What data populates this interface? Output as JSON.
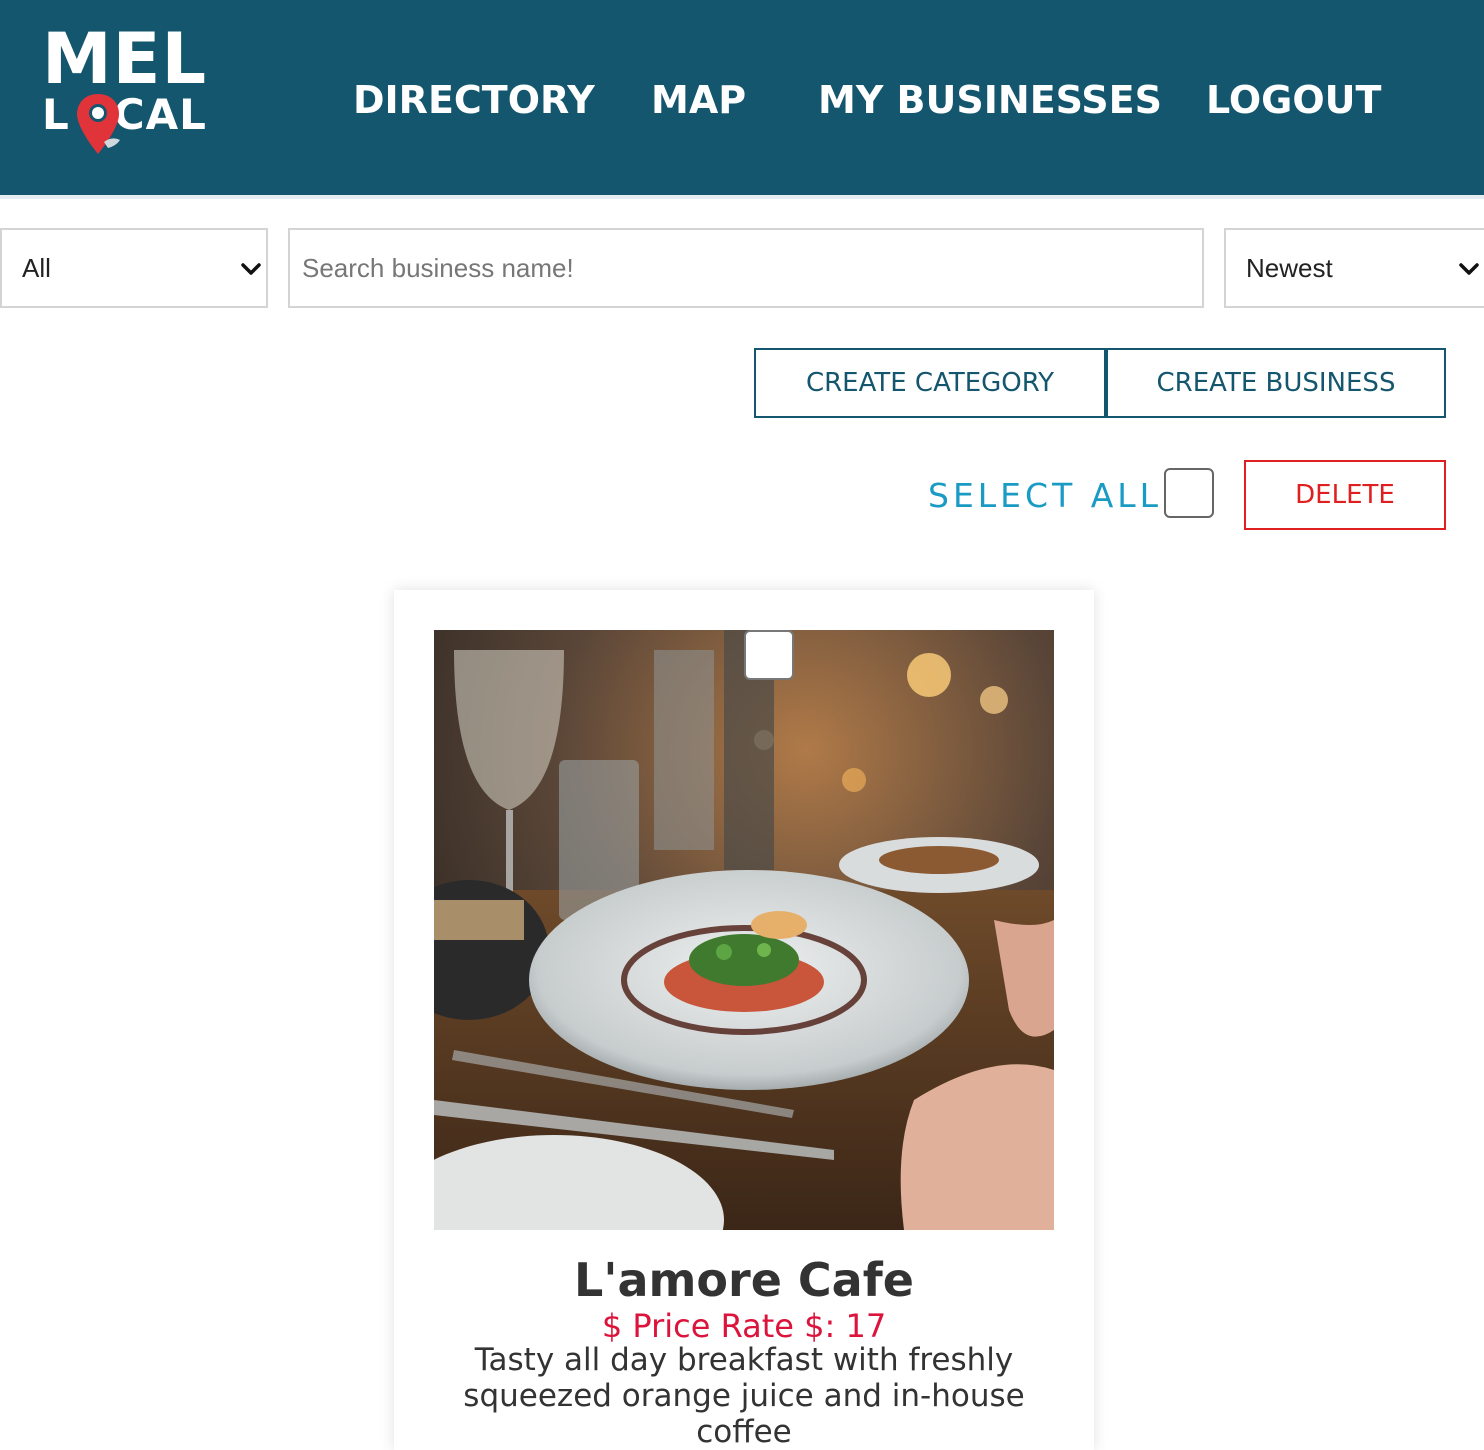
{
  "header": {
    "logo_top": "MEL",
    "logo_bottom_left": "L",
    "logo_bottom_right": "CAL",
    "nav": [
      "DIRECTORY",
      "MAP",
      "MY BUSINESSES",
      "LOGOUT"
    ],
    "background_color": "#14566e"
  },
  "filters": {
    "category_selected": "All",
    "search_placeholder": "Search business name!",
    "sort_selected": "Newest"
  },
  "actions": {
    "create_category": "CREATE CATEGORY",
    "create_business": "CREATE BUSINESS",
    "select_all": "SELECT ALL",
    "delete": "DELETE"
  },
  "businesses": [
    {
      "name": "L'amore Cafe",
      "price": "$ Price Rate $: 17",
      "description": "Tasty all day breakfast with freshly squeezed orange juice and in-house coffee",
      "image": "restaurant-plate-photo"
    }
  ],
  "colors": {
    "accent": "#14566e",
    "select_all": "#1a9bc4",
    "delete": "#e02020",
    "price": "#dc143c"
  }
}
